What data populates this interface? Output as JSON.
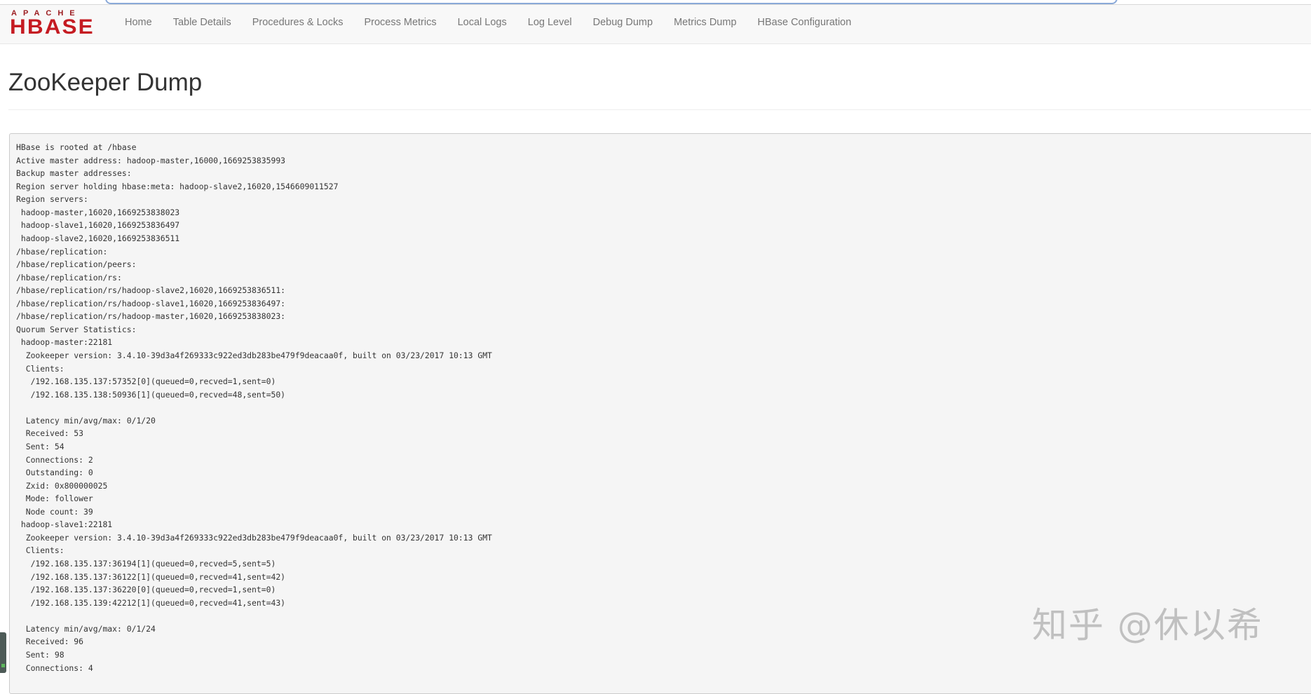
{
  "brand": {
    "top_text": "APACHE",
    "main_text": "HBASE"
  },
  "nav": {
    "items": [
      {
        "label": "Home"
      },
      {
        "label": "Table Details"
      },
      {
        "label": "Procedures & Locks"
      },
      {
        "label": "Process Metrics"
      },
      {
        "label": "Local Logs"
      },
      {
        "label": "Log Level"
      },
      {
        "label": "Debug Dump"
      },
      {
        "label": "Metrics Dump"
      },
      {
        "label": "HBase Configuration"
      }
    ]
  },
  "page": {
    "title": "ZooKeeper Dump"
  },
  "dump": {
    "lines": [
      "HBase is rooted at /hbase",
      "Active master address: hadoop-master,16000,1669253835993",
      "Backup master addresses:",
      "Region server holding hbase:meta: hadoop-slave2,16020,1546609011527",
      "Region servers:",
      " hadoop-master,16020,1669253838023",
      " hadoop-slave1,16020,1669253836497",
      " hadoop-slave2,16020,1669253836511",
      "/hbase/replication:",
      "/hbase/replication/peers:",
      "/hbase/replication/rs:",
      "/hbase/replication/rs/hadoop-slave2,16020,1669253836511:",
      "/hbase/replication/rs/hadoop-slave1,16020,1669253836497:",
      "/hbase/replication/rs/hadoop-master,16020,1669253838023:",
      "Quorum Server Statistics:",
      " hadoop-master:22181",
      "  Zookeeper version: 3.4.10-39d3a4f269333c922ed3db283be479f9deacaa0f, built on 03/23/2017 10:13 GMT",
      "  Clients:",
      "   /192.168.135.137:57352[0](queued=0,recved=1,sent=0)",
      "   /192.168.135.138:50936[1](queued=0,recved=48,sent=50)",
      "",
      "  Latency min/avg/max: 0/1/20",
      "  Received: 53",
      "  Sent: 54",
      "  Connections: 2",
      "  Outstanding: 0",
      "  Zxid: 0x800000025",
      "  Mode: follower",
      "  Node count: 39",
      " hadoop-slave1:22181",
      "  Zookeeper version: 3.4.10-39d3a4f269333c922ed3db283be479f9deacaa0f, built on 03/23/2017 10:13 GMT",
      "  Clients:",
      "   /192.168.135.137:36194[1](queued=0,recved=5,sent=5)",
      "   /192.168.135.137:36122[1](queued=0,recved=41,sent=42)",
      "   /192.168.135.137:36220[0](queued=0,recved=1,sent=0)",
      "   /192.168.135.139:42212[1](queued=0,recved=41,sent=43)",
      "",
      "  Latency min/avg/max: 0/1/24",
      "  Received: 96",
      "  Sent: 98",
      "  Connections: 4"
    ]
  },
  "watermark": {
    "text": "知乎 @休以希"
  },
  "colors": {
    "brand_red": "#c51b22",
    "nav_bg": "#f8f8f8",
    "nav_text": "#777777",
    "dump_bg": "#f5f5f5"
  }
}
